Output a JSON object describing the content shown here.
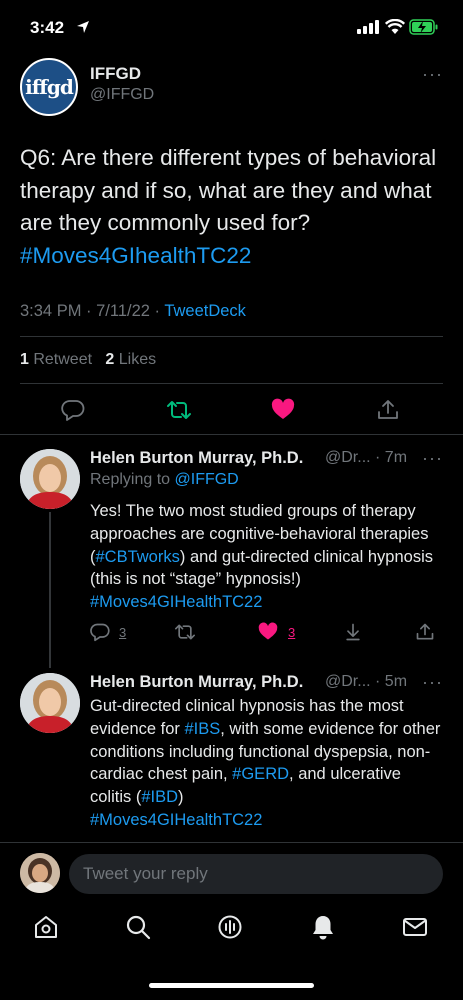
{
  "status_bar": {
    "time": "3:42"
  },
  "tweet": {
    "avatar_text": "iffgd",
    "author_name": "IFFGD",
    "author_handle": "@IFFGD",
    "more": "···",
    "text_plain": "Q6: Are there different types of behavioral therapy and if so, what are they and what are they commonly used for? ",
    "text_hashtag": "#Moves4GIhealthTC22",
    "timestamp": "3:34 PM · 7/11/22 · ",
    "source": "TweetDeck",
    "retweet_count": "1",
    "retweet_label": " Retweet",
    "like_count": "2",
    "like_label": " Likes"
  },
  "replies": [
    {
      "author_name": "Helen Burton Murray, Ph.D.",
      "author_handle_time": "@Dr... · 7m",
      "more": "···",
      "replying_prefix": "Replying to ",
      "replying_to": "@IFFGD",
      "t1": "Yes! The two most studied groups of therapy approaches are cognitive-behavioral therapies (",
      "t2": "#CBTworks",
      "t3": ") and gut-directed clinical hypnosis (this is not “stage” hypnosis!) ",
      "t4": "#Moves4GIHealthTC22",
      "reply_count": "3",
      "like_count": "3"
    },
    {
      "author_name": "Helen Burton Murray, Ph.D.",
      "author_handle_time": "@Dr... · 5m",
      "more": "···",
      "t1": "Gut-directed clinical hypnosis has the most evidence for ",
      "t2": "#IBS",
      "t3": ", with some evidence for other conditions including functional dyspepsia, non-cardiac chest pain, ",
      "t4": "#GERD",
      "t5": ", and ulcerative colitis (",
      "t6": "#IBD",
      "t7": ")",
      "t8": "#Moves4GIHealthTC22"
    }
  ],
  "compose": {
    "placeholder": "Tweet your reply"
  },
  "tabs": [
    "home-icon",
    "search-icon",
    "spaces-icon",
    "notifications-icon",
    "messages-icon"
  ],
  "colors": {
    "accent": "#1d9bf0",
    "like": "#f91880",
    "retweet": "#00ba7c",
    "battery": "#30d158"
  }
}
